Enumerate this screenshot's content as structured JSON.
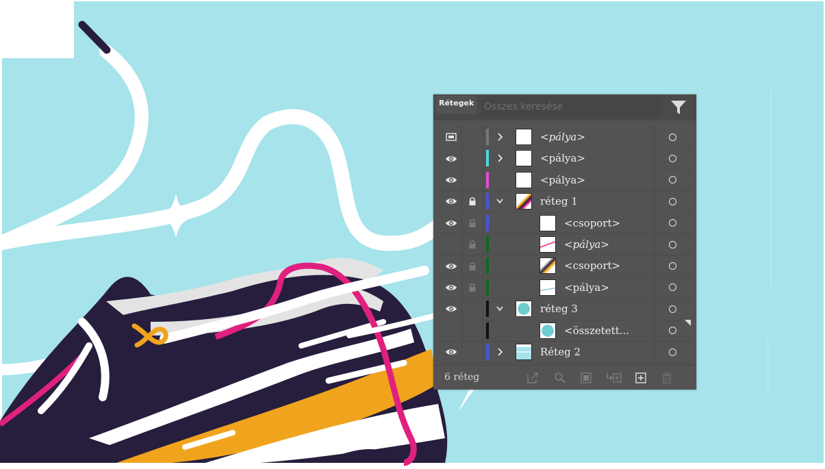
{
  "panel": {
    "tab_title": "Rétegek",
    "search_placeholder": "Összes keresése",
    "layer_count": "6 réteg",
    "footer_icons": [
      "export-icon",
      "search-icon",
      "clipping-mask-icon",
      "new-sublayer-icon",
      "new-layer-icon",
      "trash-icon"
    ]
  },
  "layers": [
    {
      "name": "<pálya>",
      "italic": true,
      "visibility": "template",
      "locked": false,
      "color": "#777777",
      "expand": "collapsed",
      "indent": 0
    },
    {
      "name": "<pálya>",
      "italic": false,
      "visibility": "visible",
      "locked": false,
      "color": "#4fd9e0",
      "expand": "collapsed",
      "indent": 0
    },
    {
      "name": "<pálya>",
      "italic": false,
      "visibility": "visible",
      "locked": false,
      "color": "#e14fd6",
      "expand": "none",
      "indent": 0
    },
    {
      "name": "réteg 1",
      "italic": false,
      "visibility": "visible",
      "locked": true,
      "color": "#4a55d9",
      "expand": "expanded",
      "indent": 0
    },
    {
      "name": "<csoport>",
      "italic": false,
      "visibility": "visible",
      "locked": true,
      "color": "#4a55d9",
      "expand": "none",
      "indent": 1
    },
    {
      "name": "<pálya>",
      "italic": true,
      "visibility": "hidden",
      "locked": true,
      "color": "#116622",
      "expand": "none",
      "indent": 1
    },
    {
      "name": "<csoport>",
      "italic": false,
      "visibility": "visible",
      "locked": true,
      "color": "#116622",
      "expand": "none",
      "indent": 1
    },
    {
      "name": "<pálya>",
      "italic": false,
      "visibility": "visible",
      "locked": true,
      "color": "#116622",
      "expand": "none",
      "indent": 1
    },
    {
      "name": "réteg 3",
      "italic": false,
      "visibility": "visible",
      "locked": false,
      "color": "#111111",
      "expand": "expanded",
      "indent": 0
    },
    {
      "name": "<összetett...",
      "italic": false,
      "visibility": "hidden",
      "locked": false,
      "color": "#111111",
      "expand": "none",
      "indent": 1
    },
    {
      "name": "Réteg 2",
      "italic": false,
      "visibility": "visible",
      "locked": false,
      "color": "#4a55d9",
      "expand": "collapsed",
      "indent": 0
    }
  ],
  "colors": {
    "artboard_bg": "#a6e3ea",
    "shoe_dark": "#271d3d",
    "shoe_orange": "#f0a41d",
    "lace_pink": "#e0207f",
    "shoe_gray": "#e3e3e3",
    "panel_bg": "#535353"
  },
  "artwork_icons": [
    "sparkle-icon",
    "shoelace-illustration",
    "sneaker-illustration"
  ]
}
